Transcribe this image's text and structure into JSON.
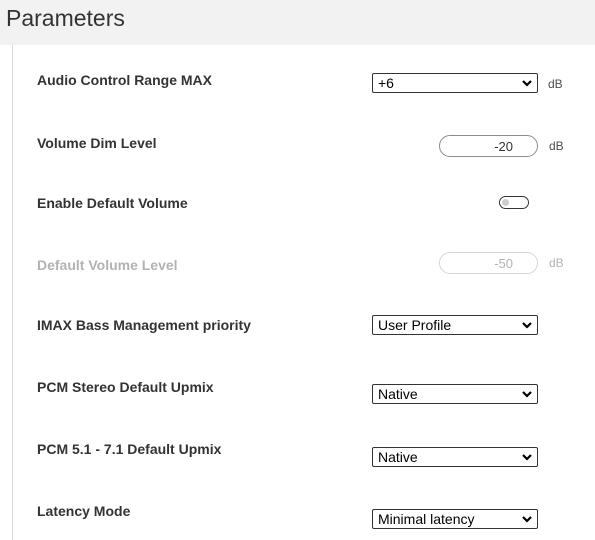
{
  "header": {
    "title": "Parameters"
  },
  "rows": {
    "audio_control_range": {
      "label": "Audio Control Range MAX",
      "value": "+6",
      "unit": "dB"
    },
    "volume_dim_level": {
      "label": "Volume Dim Level",
      "value": "-20",
      "unit": "dB"
    },
    "enable_default_volume": {
      "label": "Enable Default Volume",
      "enabled": false
    },
    "default_volume_level": {
      "label": "Default Volume Level",
      "value": "-50",
      "unit": "dB",
      "disabled": true
    },
    "imax_bass": {
      "label": "IMAX Bass Management priority",
      "value": "User Profile"
    },
    "pcm_stereo": {
      "label": "PCM Stereo Default Upmix",
      "value": "Native"
    },
    "pcm_51_71": {
      "label": "PCM 5.1 - 7.1 Default Upmix",
      "value": "Native"
    },
    "latency_mode": {
      "label": "Latency Mode",
      "value": "Minimal latency"
    }
  },
  "icons": {
    "select_arrow": "chevron-down-icon"
  }
}
